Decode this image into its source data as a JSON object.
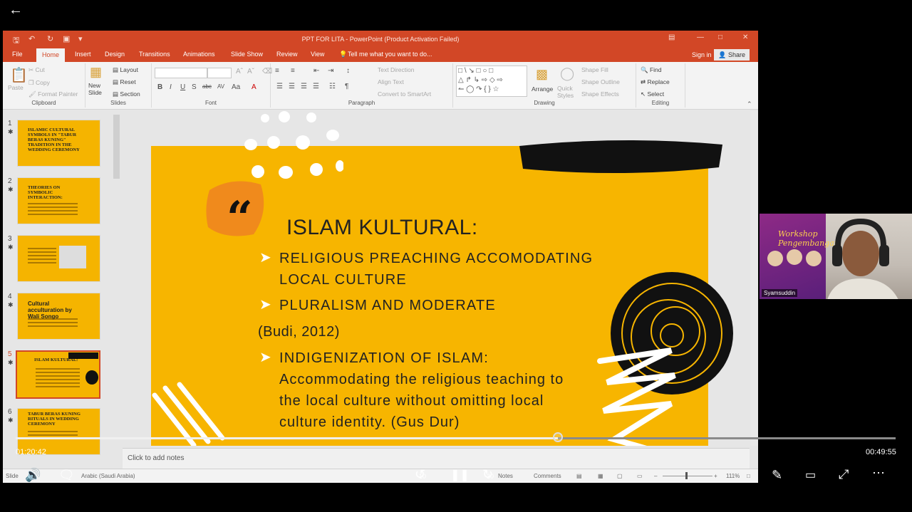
{
  "player": {
    "elapsed": "01:20:42",
    "remaining": "00:49:55",
    "progress_fraction": 0.616,
    "skip_back": "10",
    "skip_forward": "30"
  },
  "powerpoint": {
    "window_title": "PPT FOR LITA - PowerPoint (Product Activation Failed)",
    "tabs": [
      "File",
      "Home",
      "Insert",
      "Design",
      "Transitions",
      "Animations",
      "Slide Show",
      "Review",
      "View"
    ],
    "active_tab": "Home",
    "tell_me": "Tell me what you want to do...",
    "sign_in": "Sign in",
    "share": "Share",
    "ribbon": {
      "clipboard": {
        "label": "Clipboard",
        "paste": "Paste",
        "cut": "Cut",
        "copy": "Copy",
        "format_painter": "Format Painter"
      },
      "slides": {
        "label": "Slides",
        "new_slide": "New Slide",
        "layout": "Layout",
        "reset": "Reset",
        "section": "Section"
      },
      "font": {
        "label": "Font"
      },
      "paragraph": {
        "label": "Paragraph",
        "text_direction": "Text Direction",
        "align_text": "Align Text",
        "convert_smartart": "Convert to SmartArt"
      },
      "drawing": {
        "label": "Drawing",
        "arrange": "Arrange",
        "quick_styles": "Quick Styles",
        "shape_fill": "Shape Fill",
        "shape_outline": "Shape Outline",
        "shape_effects": "Shape Effects"
      },
      "editing": {
        "label": "Editing",
        "find": "Find",
        "replace": "Replace",
        "select": "Select"
      }
    },
    "thumbnails": [
      {
        "num": "1",
        "title": "ISLAMIC CULTURAL SYMBOLS IN \"TABUR BERAS KUNING\" TRADITION IN THE WEDDING CEREMONY"
      },
      {
        "num": "2",
        "title": "THEORIES ON SYMBOLIC INTERACTION:"
      },
      {
        "num": "3",
        "title": ""
      },
      {
        "num": "4",
        "title": "Cultural acculturation by Wali Songo"
      },
      {
        "num": "5",
        "title": "ISLAM KULTURAL:"
      },
      {
        "num": "6",
        "title": "TABUR BERAS KUNING RITUALS IN WEDDING CEREMONY"
      }
    ],
    "slide": {
      "title": "ISLAM KULTURAL:",
      "lines": [
        "RELIGIOUS PREACHING ACCOMODATING",
        "LOCAL CULTURE",
        "PLURALISM AND MODERATE",
        "(Budi, 2012)",
        "INDIGENIZATION OF ISLAM:",
        "Accommodating the religious teaching to",
        "the local culture without omitting local",
        "culture identity. (Gus Dur)"
      ]
    },
    "notes_placeholder": "Click to add notes",
    "status": {
      "slide": "Slide",
      "language": "Arabic (Saudi Arabia)",
      "notes": "Notes",
      "comments": "Comments",
      "zoom": "111%"
    }
  },
  "webcam": {
    "name": "Syamsuddin",
    "poster_text": "Workshop Pengembangan"
  }
}
